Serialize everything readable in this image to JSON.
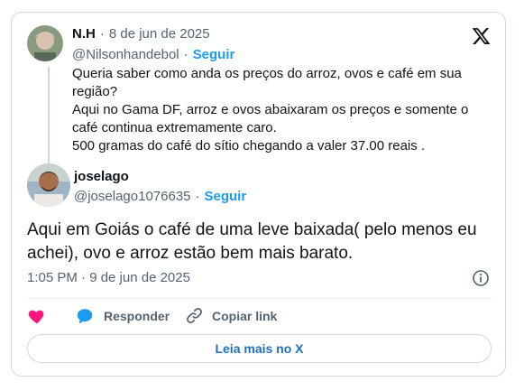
{
  "quoted_post": {
    "author_name": "N.H",
    "date": "8 de jun de 2025",
    "handle": "@Nilsonhandebol",
    "follow_label": "Seguir",
    "text": "Queria saber como anda os preços do arroz, ovos e café em sua\nregião?\nAqui no Gama DF,  arroz e ovos abaixaram os preços e somente o\ncafé continua extremamente caro.\n500 gramas do café do sítio chegando a valer 37.00 reais ."
  },
  "reply_post": {
    "author_name": "joselago",
    "handle": "@joselago1076635",
    "follow_label": "Seguir",
    "text": "Aqui em Goiás o café de uma leve baixada( pelo menos eu achei), ovo e arroz estão bem mais barato.",
    "timestamp": "1:05 PM · 9 de jun de 2025"
  },
  "actions": {
    "reply_label": "Responder",
    "copy_link_label": "Copiar link"
  },
  "footer": {
    "read_more_label": "Leia mais no X"
  },
  "colors": {
    "accent": "#1d9bf0",
    "like": "#f91880",
    "muted": "#536471"
  },
  "icons": [
    "x-logo-icon",
    "info-icon",
    "heart-icon",
    "reply-icon",
    "link-icon"
  ]
}
